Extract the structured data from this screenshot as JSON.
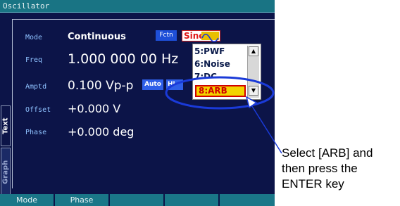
{
  "window": {
    "title": "Oscillator"
  },
  "params": [
    {
      "label": "Mode",
      "value": "Continuous"
    },
    {
      "label": "Freq",
      "value": "1.000 000 00 Hz"
    },
    {
      "label": "Amptd",
      "value": "0.100 Vp-p"
    },
    {
      "label": "Offset",
      "value": "+0.000 V"
    },
    {
      "label": "Phase",
      "value": "+0.000 deg"
    }
  ],
  "badges": {
    "fctn": "Fctn",
    "auto": "Auto",
    "hidden": "Hi"
  },
  "function_select": {
    "value": "Sine",
    "icon": "sine-wave-icon"
  },
  "dropdown": {
    "items": [
      "5:PWF",
      "6:Noise",
      "7:DC"
    ],
    "selected": "8:ARB"
  },
  "side_tabs": {
    "text": "Text",
    "graph": "Graph"
  },
  "softkeys": [
    "Mode",
    "Phase",
    "",
    "",
    ""
  ],
  "annotation": [
    "Select [ARB] and",
    "then press the",
    "ENTER key"
  ],
  "colors": {
    "screen": "#0c1448",
    "titlebar": "#197484",
    "highlight": "#f3d400",
    "annotation_ring": "#1a3ad8"
  }
}
